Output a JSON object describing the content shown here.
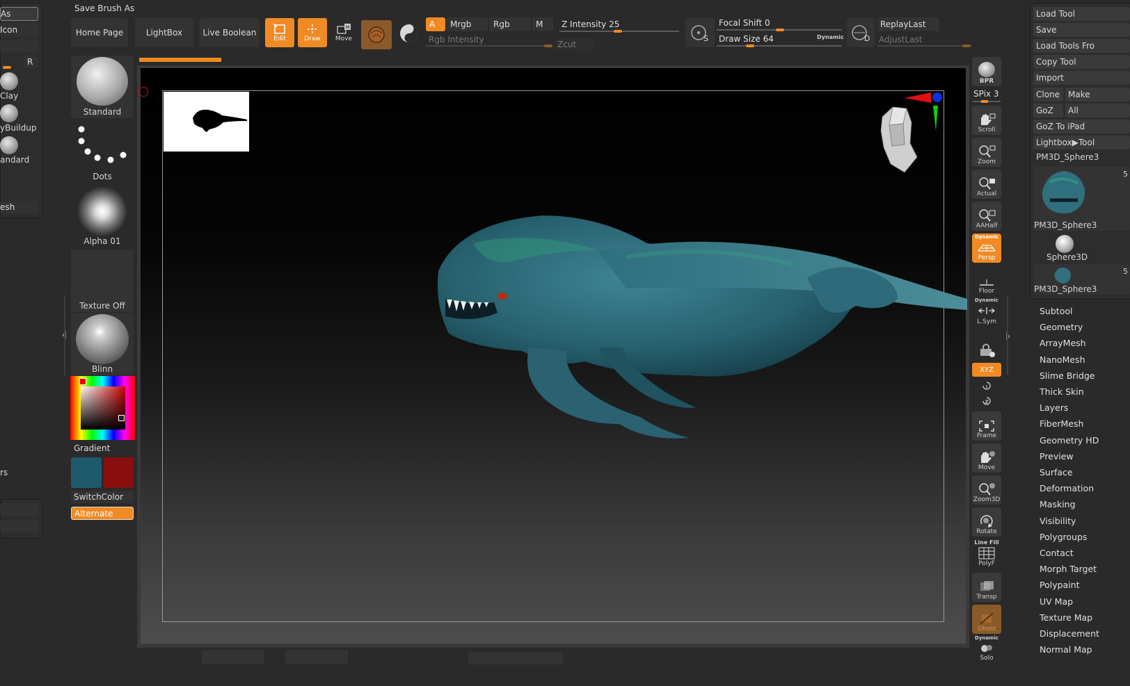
{
  "top": {
    "save_brush_as": "Save Brush As",
    "home_page": "Home Page",
    "lightbox": "LightBox",
    "live_boolean": "Live Boolean",
    "edit": "Edit",
    "draw": "Draw",
    "move": "Move",
    "a": "A",
    "mrgb": "Mrgb",
    "rgb": "Rgb",
    "m": "M",
    "rgb_intensity": "Rgb Intensity",
    "z_intensity_label": "Z Intensity",
    "z_intensity_value": "25",
    "zcut": "Zcut",
    "focal_shift_label": "Focal Shift",
    "focal_shift_value": "0",
    "draw_size_label": "Draw Size",
    "draw_size_value": "64",
    "dynamic": "Dynamic",
    "replay_last": "ReplayLast",
    "adjust_last": "AdjustLast",
    "s_letter": "S",
    "d_letter": "D"
  },
  "left_edge": {
    "item1": "As",
    "item2": "Icon",
    "r": "R",
    "clay": "Clay",
    "buildup": "yBuildup",
    "standard": "andard",
    "esh": "esh",
    "rs": "rs"
  },
  "brush_tiles": {
    "standard": "Standard",
    "dots": "Dots",
    "alpha": "Alpha 01",
    "texture": "Texture Off",
    "material": "Blinn",
    "gradient": "Gradient",
    "switch_color": "SwitchColor",
    "alternate": "Alternate"
  },
  "colors": {
    "main_color": "#1e5a6c",
    "secondary_color": "#8a0e0e",
    "accent": "#f08a24"
  },
  "right_shelf": {
    "bpr": "BPR",
    "spix_label": "SPix",
    "spix_value": "3",
    "scroll": "Scroll",
    "zoom": "Zoom",
    "actual": "Actual",
    "aahalf": "AAHalf",
    "dynamic": "Dynamic",
    "persp": "Persp",
    "floor": "Floor",
    "lsym": "L.Sym",
    "xyz": "XYZ",
    "frame": "Frame",
    "move": "Move",
    "zoom3d": "Zoom3D",
    "rotate": "Rotate",
    "line_fill": "Line Fill",
    "polyf": "PolyF",
    "transp": "Transp",
    "ghost": "Ghost",
    "solo": "Solo"
  },
  "tool_panel": {
    "load_tool": "Load Tool",
    "save": "Save",
    "load_tools_from": "Load Tools Fro",
    "copy_tool": "Copy Tool",
    "import": "Import",
    "clone": "Clone",
    "make": "Make",
    "goz": "GoZ",
    "all": "All",
    "goz_ipad": "GoZ To iPad",
    "lightbox_tools": "Lightbox▶Tool",
    "current_tool": "PM3D_Sphere3",
    "thumb1_label": "PM3D_Sphere3",
    "thumb2_label": "Sphere3D",
    "thumb3_label": "PM3D_Sphere3",
    "five": "5"
  },
  "tool_menu": [
    "Subtool",
    "Geometry",
    "ArrayMesh",
    "NanoMesh",
    "Slime Bridge",
    "Thick Skin",
    "Layers",
    "FiberMesh",
    "Geometry HD",
    "Preview",
    "Surface",
    "Deformation",
    "Masking",
    "Visibility",
    "Polygroups",
    "Contact",
    "Morph Target",
    "Polypaint",
    "UV Map",
    "Texture Map",
    "Displacement",
    "Normal Map"
  ]
}
